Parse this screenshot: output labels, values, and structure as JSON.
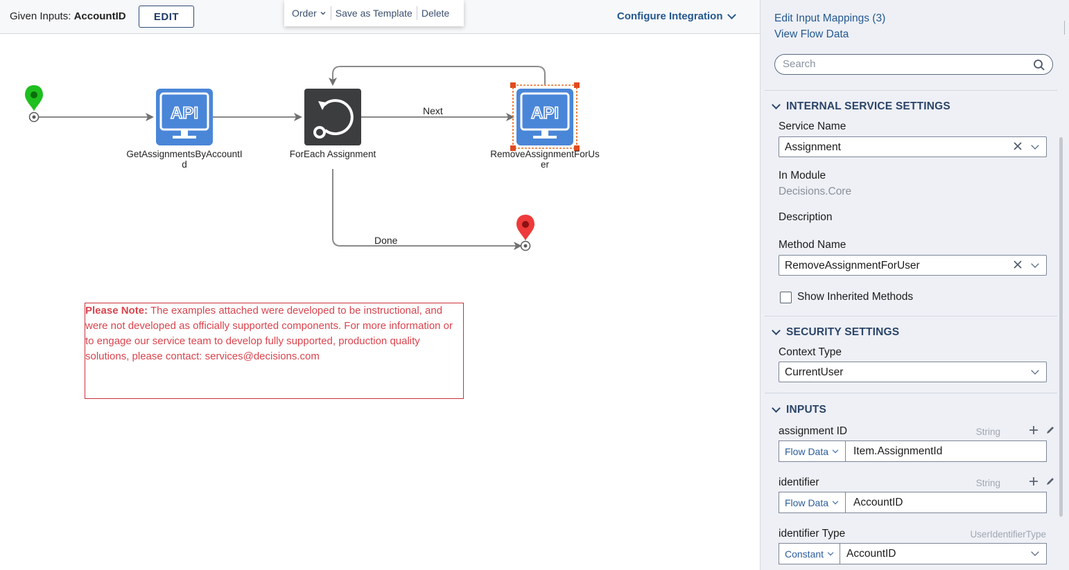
{
  "header": {
    "given_inputs_label": "Given Inputs:",
    "given_inputs_value": "AccountID",
    "edit_label": "EDIT",
    "configure_label": "Configure Integration"
  },
  "context_toolbar": {
    "order_label": "Order",
    "save_template_label": "Save as Template",
    "delete_label": "Delete"
  },
  "flow": {
    "nodes": {
      "get_assignments": "GetAssignmentsByAccountId",
      "foreach": "ForEach Assignment",
      "remove_assignment": "RemoveAssignmentForUser",
      "api_badge": "API"
    },
    "edges": {
      "next": "Next",
      "done": "Done"
    },
    "colors": {
      "start": "#1fbf1f",
      "end": "#ee3a3a",
      "api": "#4a86d8",
      "selection": "#e8681a"
    }
  },
  "note": {
    "bold": "Please Note:",
    "text": " The examples attached were developed to be instructional, and were not developed as officially supported components.  For more information or to engage our service team to develop fully supported, production quality solutions, please contact: services@decisions.com"
  },
  "panel": {
    "edit_input_mappings": "Edit Input Mappings (3)",
    "view_flow_data": "View Flow Data",
    "search_placeholder": "Search",
    "internal_service": {
      "title": "INTERNAL SERVICE SETTINGS",
      "service_name_label": "Service Name",
      "service_name_value": "Assignment",
      "in_module_label": "In Module",
      "in_module_value": "Decisions.Core",
      "description_label": "Description",
      "method_name_label": "Method Name",
      "method_name_value": "RemoveAssignmentForUser",
      "show_inherited_label": "Show Inherited Methods"
    },
    "security": {
      "title": "SECURITY SETTINGS",
      "context_type_label": "Context Type",
      "context_type_value": "CurrentUser"
    },
    "inputs": {
      "title": "INPUTS",
      "items": [
        {
          "name": "assignment ID",
          "type": "String",
          "source": "Flow Data",
          "value": "Item.AssignmentId"
        },
        {
          "name": "identifier",
          "type": "String",
          "source": "Flow Data",
          "value": "AccountID"
        },
        {
          "name": "identifier Type",
          "type": "UserIdentifierType",
          "source": "Constant",
          "value": "AccountID"
        }
      ]
    }
  }
}
